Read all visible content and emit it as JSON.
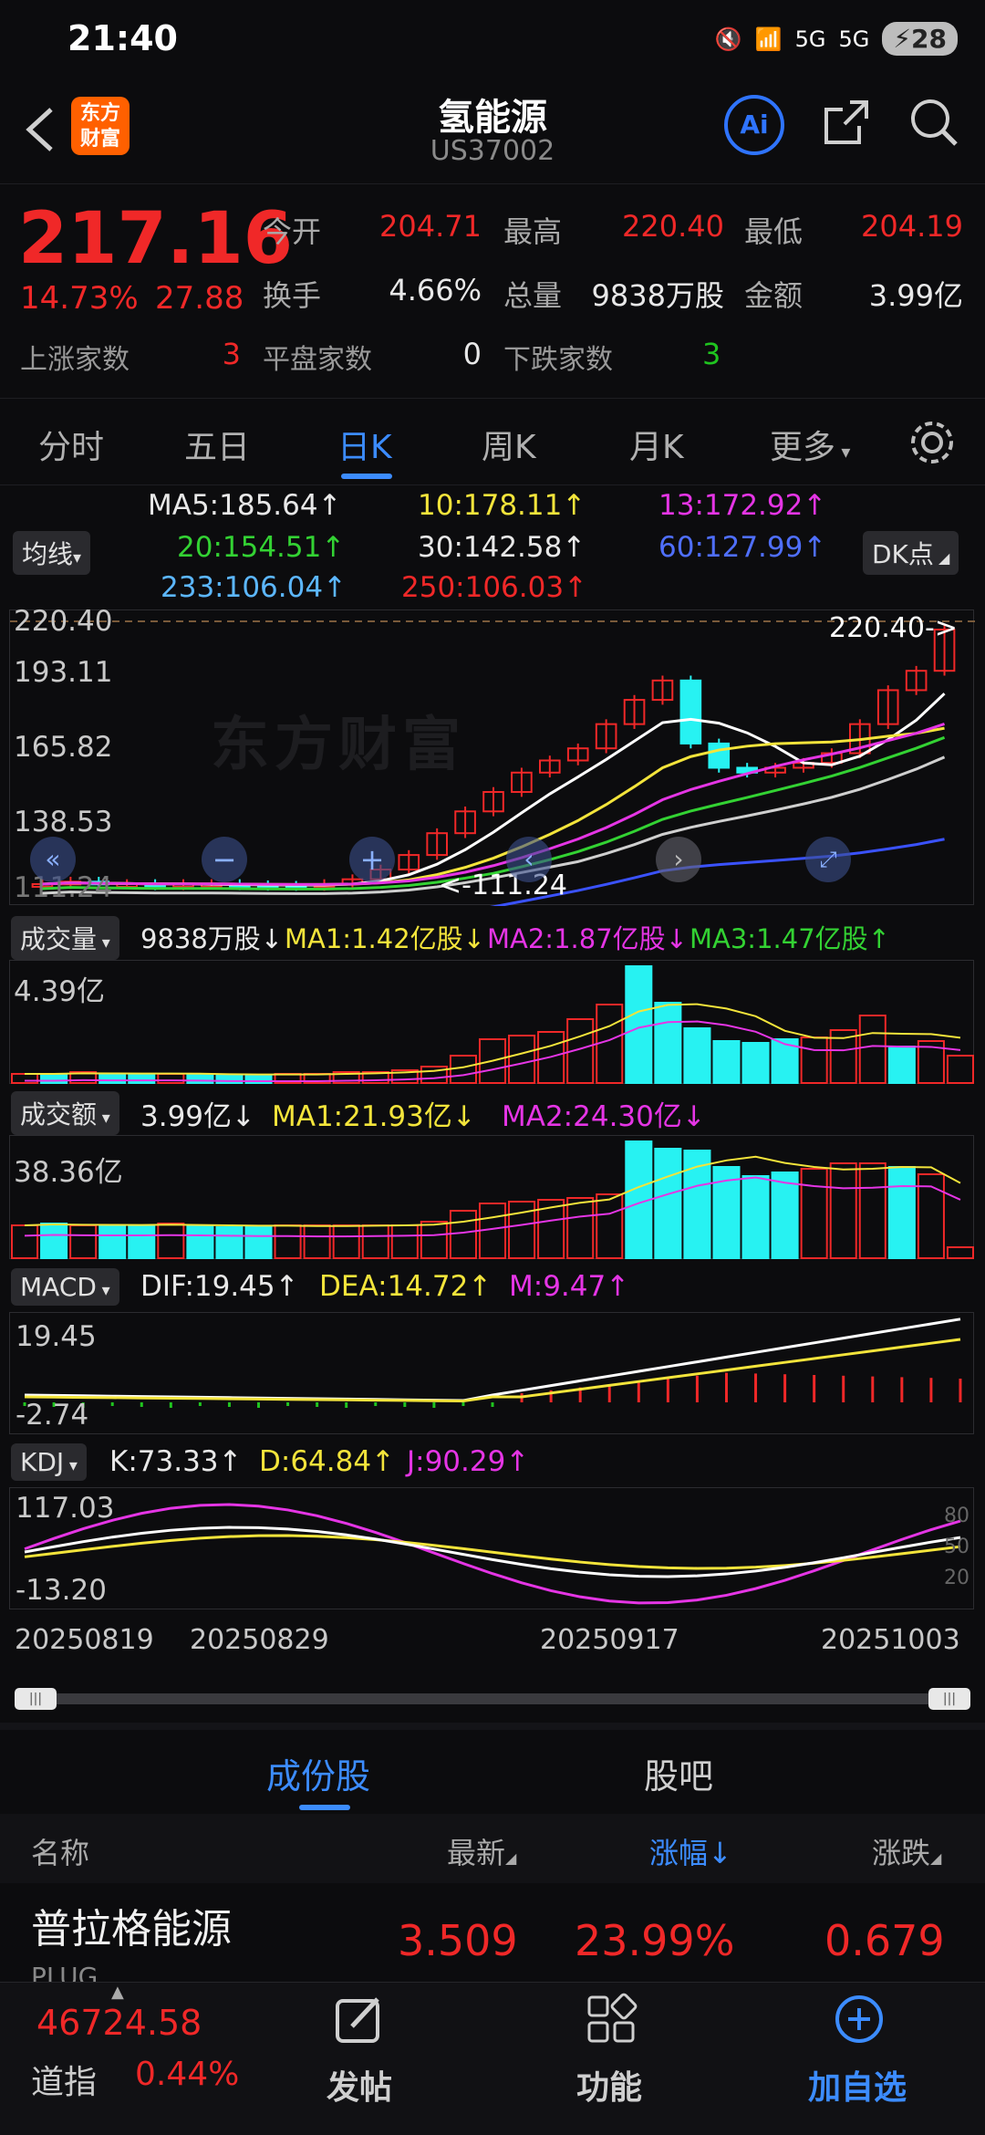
{
  "status": {
    "time": "21:40",
    "battery": "28",
    "net1": "5G",
    "net2": "5G"
  },
  "header": {
    "title": "氢能源",
    "code": "US37002",
    "logo_text": "东方\n财富",
    "ai_label": "Ai"
  },
  "quote": {
    "price": "217.16",
    "pct": "14.73%",
    "chg": "27.88",
    "open_label": "今开",
    "open": "204.71",
    "high_label": "最高",
    "high": "220.40",
    "low_label": "最低",
    "low": "204.19",
    "turnover_label": "换手",
    "turnover": "4.66%",
    "volume_label": "总量",
    "volume": "9838万股",
    "amount_label": "金额",
    "amount": "3.99亿",
    "up_label": "上涨家数",
    "up": "3",
    "flat_label": "平盘家数",
    "flat": "0",
    "down_label": "下跌家数",
    "down": "3"
  },
  "tabs": [
    "分时",
    "五日",
    "日K",
    "周K",
    "月K",
    "更多"
  ],
  "active_tab": "日K",
  "ma": {
    "selector": "均线",
    "dk": "DK点",
    "ma5": "MA5:185.64↑",
    "ma10": "10:178.11↑",
    "ma13": "13:172.92↑",
    "ma20": "20:154.51↑",
    "ma30": "30:142.58↑",
    "ma60": "60:127.99↑",
    "ma233": "233:106.04↑",
    "ma250": "250:106.03↑"
  },
  "kline": {
    "y_labels": [
      "220.40",
      "193.11",
      "165.82",
      "138.53",
      "111.24"
    ],
    "max_marker": "220.40->",
    "min_marker": "<-111.24",
    "watermark": "东方财富",
    "colors": {
      "up": "#f02828",
      "down": "#27f2f2",
      "ma5": "#ffffff",
      "ma10": "#f3e43b",
      "ma20": "#e535e5",
      "ma30": "#33d233",
      "ma60": "#cfcfcf",
      "ma250": "#3a52ff"
    }
  },
  "volume": {
    "selector": "成交量",
    "value": "9838万股↓",
    "ma1": "MA1:1.42亿股↓",
    "ma2": "MA2:1.87亿股↓",
    "ma3": "MA3:1.47亿股↑",
    "y_label": "4.39亿"
  },
  "amount": {
    "selector": "成交额",
    "value": "3.99亿↓",
    "ma1": "MA1:21.93亿↓",
    "ma2": "MA2:24.30亿↓",
    "y_label": "38.36亿"
  },
  "macd": {
    "selector": "MACD",
    "dif": "DIF:19.45↑",
    "dea": "DEA:14.72↑",
    "m": "M:9.47↑",
    "y_top": "19.45",
    "y_bottom": "-2.74"
  },
  "kdj": {
    "selector": "KDJ",
    "k": "K:73.33↑",
    "d": "D:64.84↑",
    "j": "J:90.29↑",
    "y_top": "117.03",
    "y_bottom": "-13.20",
    "levels": [
      "80",
      "50",
      "20"
    ]
  },
  "dates": [
    "20250819",
    "20250829",
    "20250917",
    "20251003"
  ],
  "stock_tabs": [
    "成份股",
    "股吧"
  ],
  "list_header": {
    "name": "名称",
    "latest": "最新",
    "pct": "涨幅↓",
    "chg": "涨跌"
  },
  "list_rows": [
    {
      "name": "普拉格能源",
      "code": "PLUG",
      "latest": "3.509",
      "pct": "23.99%",
      "chg": "0.679"
    }
  ],
  "bottom": {
    "index_value": "46724.58",
    "index_name": "道指",
    "index_pct": "0.44%",
    "post": "发帖",
    "func": "功能",
    "add": "加自选"
  }
}
